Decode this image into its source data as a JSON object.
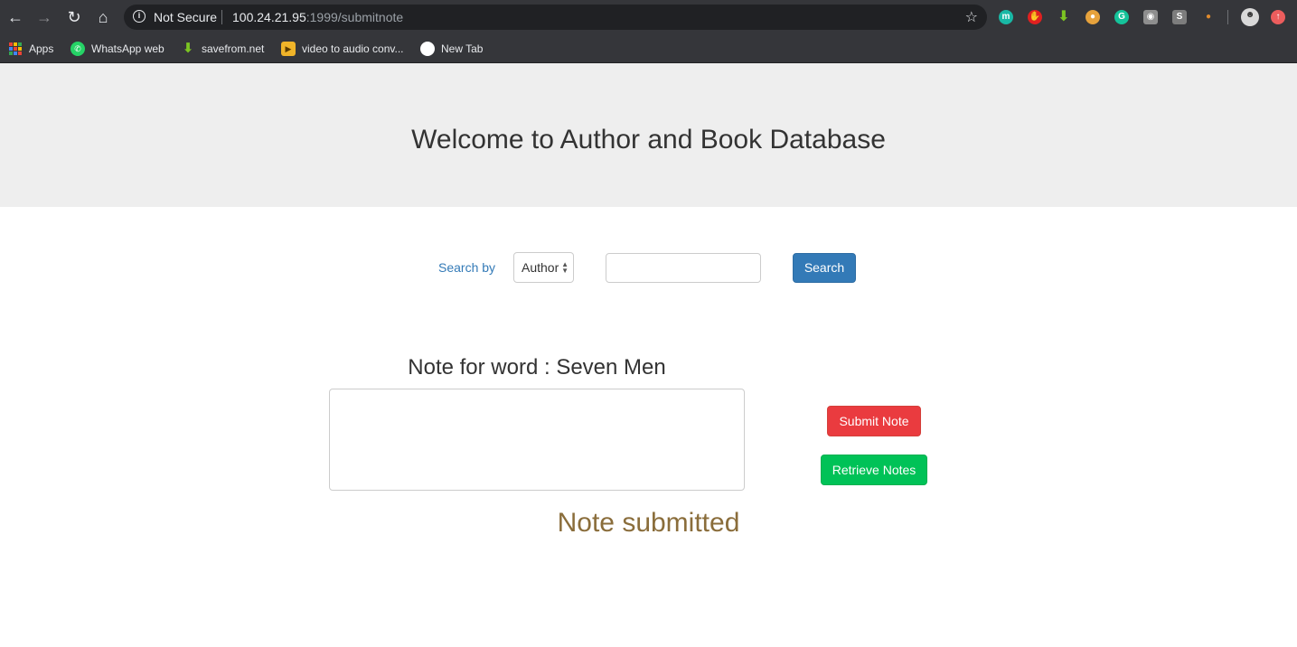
{
  "browser": {
    "security_label": "Not Secure",
    "url_host": "100.24.21.95",
    "url_rest": ":1999/submitnote",
    "bookmarks": [
      {
        "label": "Apps",
        "icon": "apps-grid-icon"
      },
      {
        "label": "WhatsApp web",
        "icon": "whatsapp-icon"
      },
      {
        "label": "savefrom.net",
        "icon": "download-arrow-icon"
      },
      {
        "label": "video to audio conv...",
        "icon": "video-camera-icon"
      },
      {
        "label": "New Tab",
        "icon": "globe-icon"
      }
    ],
    "extensions": [
      "m-extension-icon",
      "hand-extension-icon",
      "download-extension-icon",
      "cookie-extension-icon",
      "grammarly-icon",
      "camera-icon",
      "s-extension-icon",
      "ball-extension-icon",
      "profile-avatar-icon",
      "update-icon"
    ]
  },
  "header": {
    "title": "Welcome to Author and Book Database"
  },
  "search": {
    "label": "Search by",
    "selected_option": "Author",
    "input_value": "",
    "button_label": "Search"
  },
  "note": {
    "heading": "Note for word : Seven Men",
    "textarea_value": "",
    "submit_label": "Submit Note",
    "retrieve_label": "Retrieve Notes",
    "status_message": "Note submitted"
  },
  "colors": {
    "primary": "#337ab7",
    "danger": "#ea3b3f",
    "success": "#00c257",
    "status_text": "#8a6d3b"
  }
}
